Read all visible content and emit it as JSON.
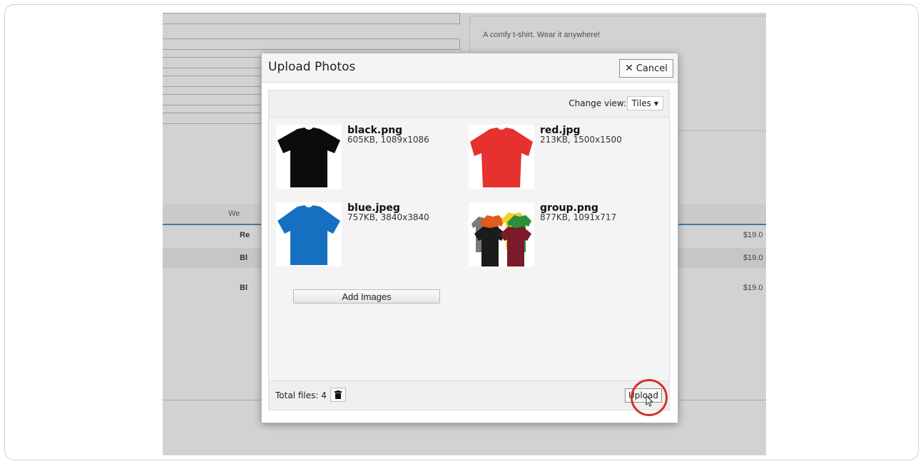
{
  "background_page": {
    "description": "A comfy t-shirt. Wear it anywhere!",
    "table_header_partial": "We",
    "rows": [
      {
        "name_partial": "Re",
        "price_partial": "$19.0"
      },
      {
        "name_partial": "Bl",
        "price_partial": "$19.0"
      },
      {
        "name_partial": "Bl",
        "price_partial": "$19.0"
      }
    ]
  },
  "modal": {
    "title": "Upload Photos",
    "cancel_label": "Cancel",
    "change_view_label": "Change view:",
    "view_selected": "Tiles",
    "files": [
      {
        "name": "black.png",
        "info": "605KB, 1089x1086",
        "shirt_color": "#0c0c0c"
      },
      {
        "name": "red.jpg",
        "info": "213KB, 1500x1500",
        "shirt_color": "#e6312e"
      },
      {
        "name": "blue.jpeg",
        "info": "757KB, 3840x3840",
        "shirt_color": "#1670c2"
      },
      {
        "name": "group.png",
        "info": "877KB, 1091x717",
        "shirt_color": "#7a1a2a"
      }
    ],
    "add_images_label": "Add Images",
    "total_files_label": "Total files: 4",
    "upload_label": "Upload"
  },
  "colors": {
    "highlight": "#d0312d",
    "accent_rule": "#3a7bb0"
  }
}
